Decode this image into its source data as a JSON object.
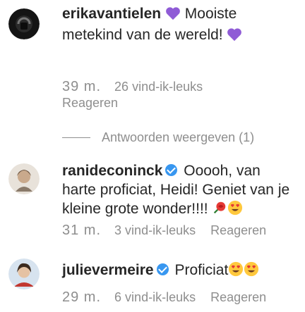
{
  "comments": [
    {
      "username": "erikavantielen",
      "text_1": "Mooiste metekind van de wereld!",
      "time": "39 m.",
      "likes": "26 vind-ik-leuks",
      "reply": "Reageren",
      "view_replies": "Antwoorden weergeven (1)",
      "avatar_icon": "avatar-dark-icon",
      "emojis": [
        "purple-heart-icon",
        "purple-heart-icon"
      ]
    },
    {
      "username": "ranideconinck",
      "verified": true,
      "text": "Ooooh, van harte proficiat, Heidi! Geniet van je kleine grote wonder!!!!",
      "time": "31 m.",
      "likes": "3 vind-ik-leuks",
      "reply": "Reageren",
      "emojis": [
        "rose-icon",
        "heart-eyes-icon"
      ]
    },
    {
      "username": "julievermeire",
      "verified": true,
      "text": "Proficiat",
      "time": "29 m.",
      "likes": "6 vind-ik-leuks",
      "reply": "Reageren",
      "emojis": [
        "heart-eyes-icon",
        "heart-eyes-icon"
      ]
    }
  ],
  "colors": {
    "text": "#262626",
    "muted": "#8e8e8e",
    "verified": "#3897f0",
    "purple_heart": "#8f5bd6"
  }
}
